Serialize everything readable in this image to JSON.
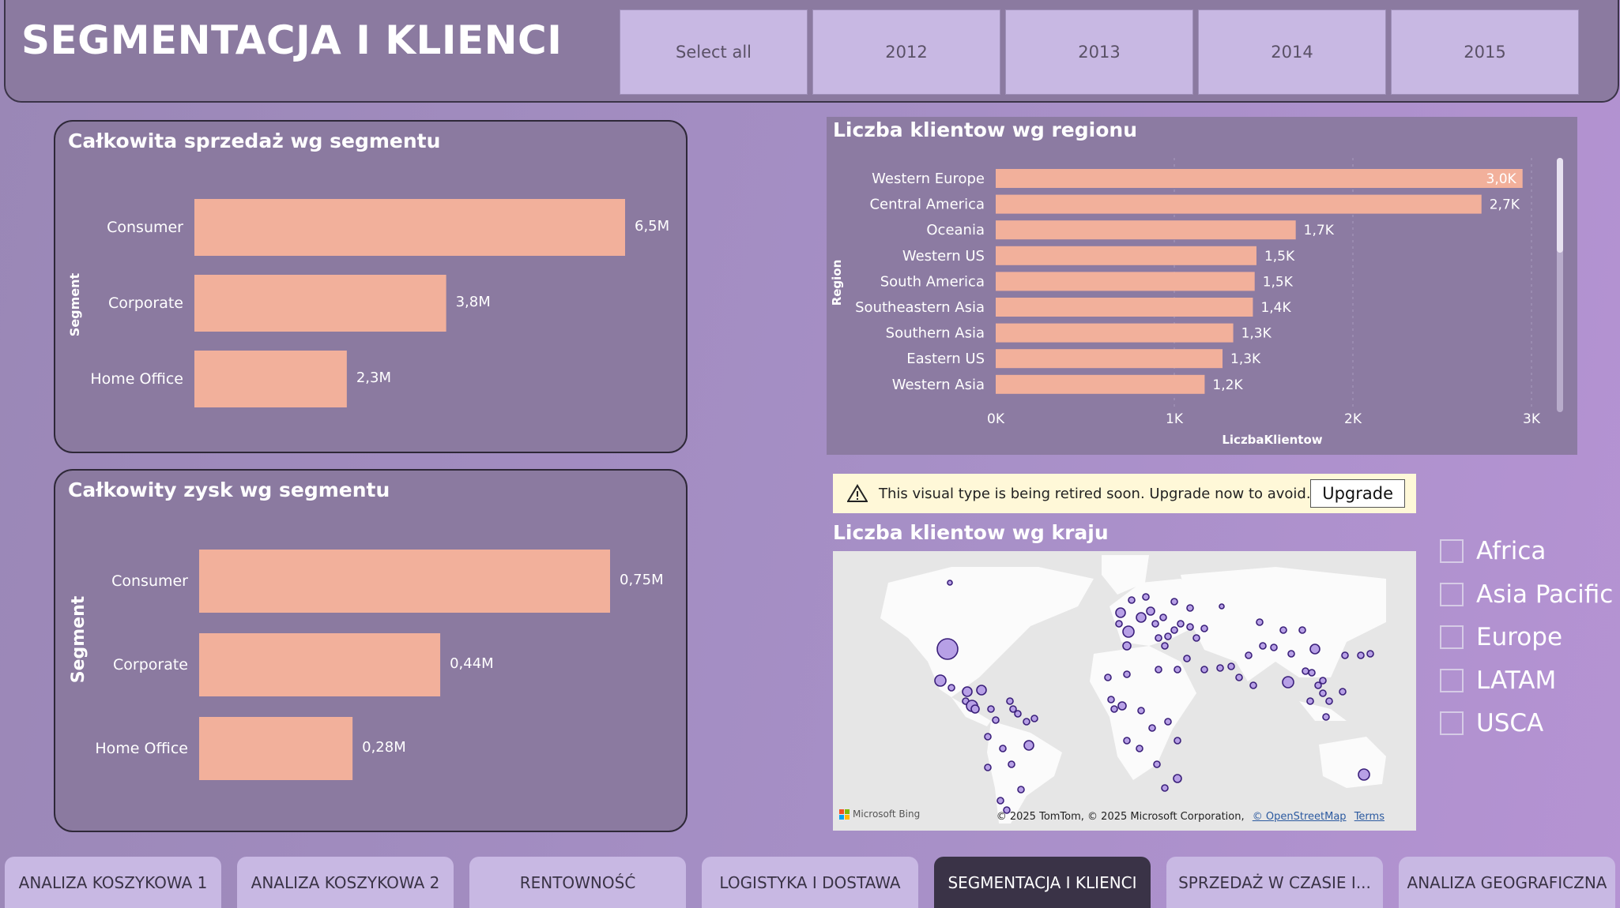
{
  "header": {
    "title": "SEGMENTACJA I KLIENCI",
    "years": [
      "Select all",
      "2012",
      "2013",
      "2014",
      "2015"
    ]
  },
  "sales_card": {
    "title": "Całkowita sprzedaż wg segmentu"
  },
  "profit_card": {
    "title": "Całkowity zysk wg segmentu"
  },
  "region_card": {
    "title": "Liczba klientow wg regionu"
  },
  "warning": {
    "text": "This visual type is being retired soon. Upgrade now to avoid...",
    "button": "Upgrade"
  },
  "map": {
    "title": "Liczba klientow wg kraju",
    "bing_label": "Microsoft Bing",
    "attribution": "© 2025 TomTom, © 2025 Microsoft Corporation,",
    "osm_link": "© OpenStreetMap",
    "terms_link": "Terms"
  },
  "legend": {
    "items": [
      "Africa",
      "Asia Pacific",
      "Europe",
      "LATAM",
      "USCA"
    ]
  },
  "tabs": [
    {
      "label": "ANALIZA KOSZYKOWA 1"
    },
    {
      "label": "ANALIZA KOSZYKOWA 2"
    },
    {
      "label": "RENTOWNOŚĆ"
    },
    {
      "label": "LOGISTYKA I DOSTAWA"
    },
    {
      "label": "SEGMENTACJA I KLIENCI",
      "active": true
    },
    {
      "label": "SPRZEDAŻ W CZASIE I..."
    },
    {
      "label": "ANALIZA GEOGRAFICZNA"
    }
  ],
  "colors": {
    "bar": "#f2b09b",
    "card_bg": "#8b7aa0",
    "dot": "#b7a0e6",
    "dot_stroke": "#3a1f7a",
    "active_tab": "#3a3347"
  },
  "chart_data": [
    {
      "type": "bar",
      "orientation": "horizontal",
      "title": "Całkowita sprzedaż wg segmentu",
      "ylabel": "Segment",
      "categories": [
        "Consumer",
        "Corporate",
        "Home Office"
      ],
      "values": [
        6.5,
        3.8,
        2.3
      ],
      "labels": [
        "6,5M",
        "3,8M",
        "2,3M"
      ]
    },
    {
      "type": "bar",
      "orientation": "horizontal",
      "title": "Całkowity zysk wg segmentu",
      "ylabel": "Segment",
      "categories": [
        "Consumer",
        "Corporate",
        "Home Office"
      ],
      "values": [
        0.75,
        0.44,
        0.28
      ],
      "labels": [
        "0,75M",
        "0,44M",
        "0,28M"
      ]
    },
    {
      "type": "bar",
      "orientation": "horizontal",
      "title": "Liczba klientow wg regionu",
      "ylabel": "Region",
      "xlabel": "LiczbaKlientow",
      "xlim": [
        0,
        3000
      ],
      "xticks": [
        "0K",
        "1K",
        "2K",
        "3K"
      ],
      "grid": true,
      "categories": [
        "Western Europe",
        "Central America",
        "Oceania",
        "Western US",
        "South America",
        "Southeastern Asia",
        "Southern Asia",
        "Eastern US",
        "Western Asia"
      ],
      "values": [
        2950,
        2720,
        1680,
        1460,
        1450,
        1440,
        1330,
        1270,
        1170
      ],
      "labels": [
        "3,0K",
        "2,7K",
        "1,7K",
        "1,5K",
        "1,5K",
        "1,4K",
        "1,3K",
        "1,3K",
        "1,2K"
      ]
    }
  ]
}
